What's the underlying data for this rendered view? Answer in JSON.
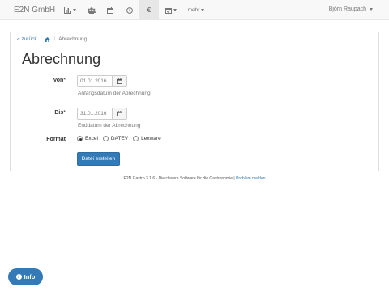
{
  "navbar": {
    "brand": "E2N GmbH",
    "items": [
      {
        "icon": "bar-chart-icon",
        "dropdown": true
      },
      {
        "icon": "users-icon"
      },
      {
        "icon": "calendar-icon"
      },
      {
        "icon": "clock-icon"
      },
      {
        "icon": "euro-icon",
        "active": true,
        "glyph": "€"
      },
      {
        "icon": "calendar-check-icon",
        "dropdown": true
      },
      {
        "label": "mehr",
        "dropdown": true
      }
    ],
    "user": "Björn Raupach"
  },
  "breadcrumb": {
    "back": "« zurück",
    "home_icon": "home-icon",
    "current": "Abrechnung"
  },
  "page": {
    "title": "Abrechnung"
  },
  "form": {
    "von": {
      "label": "Von",
      "required": "*",
      "value": "01.01.2016",
      "help": "Anfangsdatum der Abrechnung"
    },
    "bis": {
      "label": "Bis",
      "required": "*",
      "value": "31.01.2016",
      "help": "Enddatum der Abrechnung"
    },
    "format": {
      "label": "Format",
      "options": [
        "Excel",
        "DATEV",
        "Lexware"
      ],
      "selected": "Excel"
    },
    "submit": "Datei erstellen"
  },
  "footer": {
    "text": "E2N Gastro 3.1.6 · Die clevere Software für die Gastronomie | ",
    "link": "Problem melden"
  },
  "info_button": "Info",
  "colors": {
    "primary": "#337ab7",
    "navbar": "#f8f8f8",
    "active_nav": "#e7e7e7"
  }
}
